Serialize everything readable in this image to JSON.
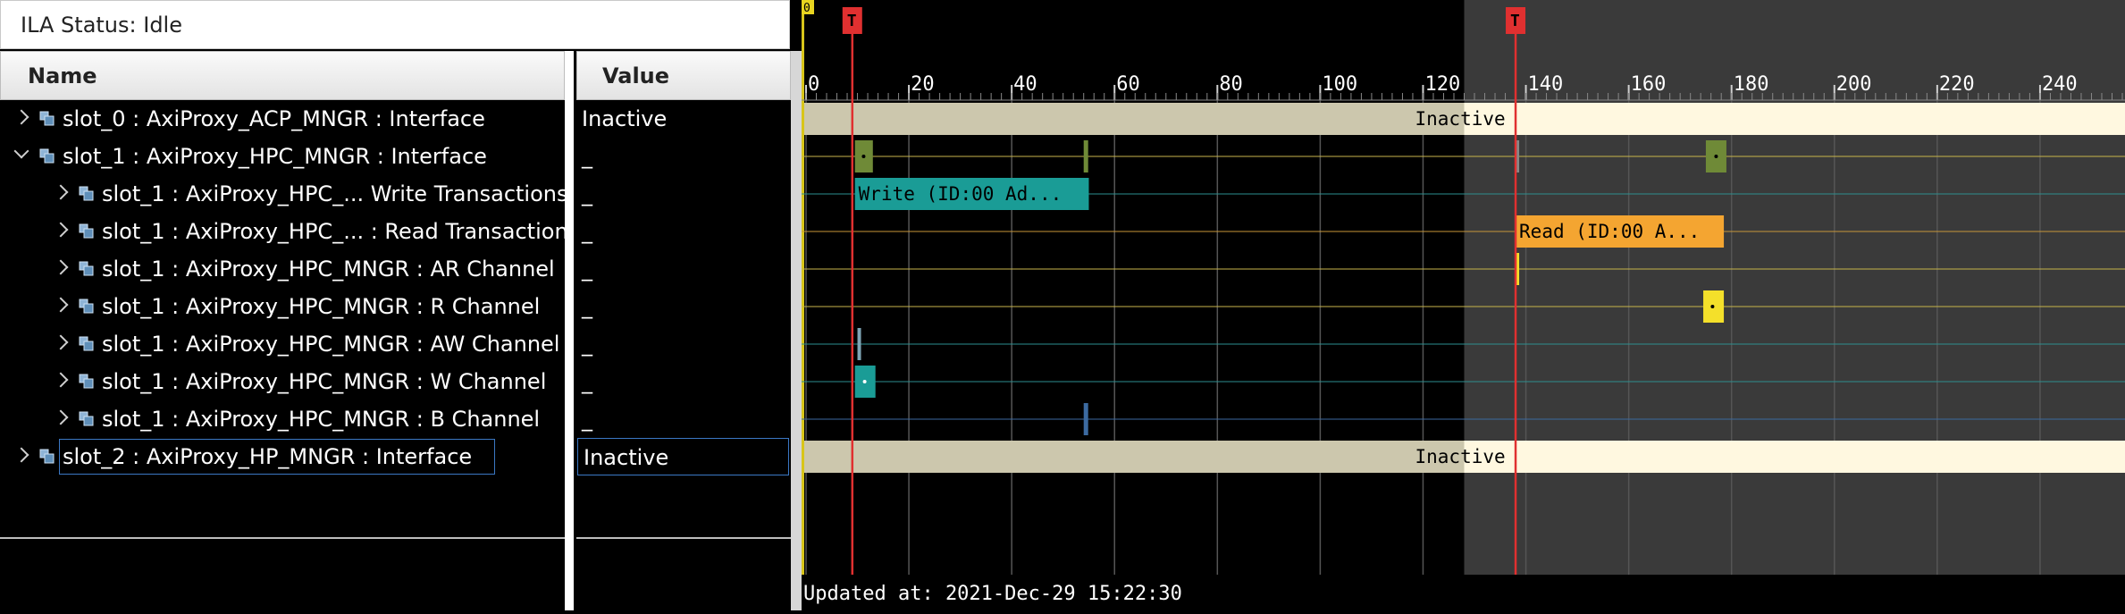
{
  "status": {
    "text": "ILA Status: Idle"
  },
  "columns": {
    "name": "Name",
    "value": "Value"
  },
  "rows": [
    {
      "name": "slot_0 : AxiProxy_ACP_MNGR : Interface",
      "value": "Inactive",
      "expander": "collapsed",
      "indent": 0
    },
    {
      "name": "slot_1 : AxiProxy_HPC_MNGR : Interface",
      "value": "_",
      "expander": "expanded",
      "indent": 0
    },
    {
      "name": "slot_1 : AxiProxy_HPC_... Write Transactions",
      "value": "_",
      "expander": "collapsed",
      "indent": 1
    },
    {
      "name": "slot_1 : AxiProxy_HPC_... : Read Transactions",
      "value": "_",
      "expander": "collapsed",
      "indent": 1
    },
    {
      "name": "slot_1 : AxiProxy_HPC_MNGR : AR Channel",
      "value": "_",
      "expander": "collapsed",
      "indent": 1
    },
    {
      "name": "slot_1 : AxiProxy_HPC_MNGR : R Channel",
      "value": "_",
      "expander": "collapsed",
      "indent": 1
    },
    {
      "name": "slot_1 : AxiProxy_HPC_MNGR : AW Channel",
      "value": "_",
      "expander": "collapsed",
      "indent": 1
    },
    {
      "name": "slot_1 : AxiProxy_HPC_MNGR : W Channel",
      "value": "_",
      "expander": "collapsed",
      "indent": 1
    },
    {
      "name": "slot_1 : AxiProxy_HPC_MNGR : B Channel",
      "value": "_",
      "expander": "collapsed",
      "indent": 1
    },
    {
      "name": "slot_2 : AxiProxy_HP_MNGR : Interface",
      "value": "Inactive",
      "expander": "collapsed",
      "indent": 0,
      "selected": true
    }
  ],
  "waveform": {
    "origin_marker": "0",
    "trigger_label": "T",
    "time_min": 0,
    "time_max": 256,
    "tick_labels": [
      "0",
      "20",
      "40",
      "60",
      "80",
      "100",
      "120",
      "140",
      "160",
      "180",
      "200",
      "220",
      "240"
    ],
    "tick_values": [
      0,
      20,
      40,
      60,
      80,
      100,
      120,
      140,
      160,
      180,
      200,
      220,
      240
    ],
    "trigger_times": [
      9,
      138
    ],
    "post_trigger_start": 128,
    "transactions": {
      "inactive_label": "Inactive",
      "write_label": "Write (ID:00 Ad...",
      "read_label": "Read (ID:00 A..."
    },
    "colors": {
      "inactive": "#ccc7ad",
      "inactive_post": "#fff8e0",
      "write": "#1a9c96",
      "read": "#f4a531",
      "marker": "#e03030",
      "channel_green": "#6f8a37",
      "yellow": "#f4e02a"
    }
  },
  "footer": {
    "updated": "Updated at: 2021-Dec-29 15:22:30"
  }
}
